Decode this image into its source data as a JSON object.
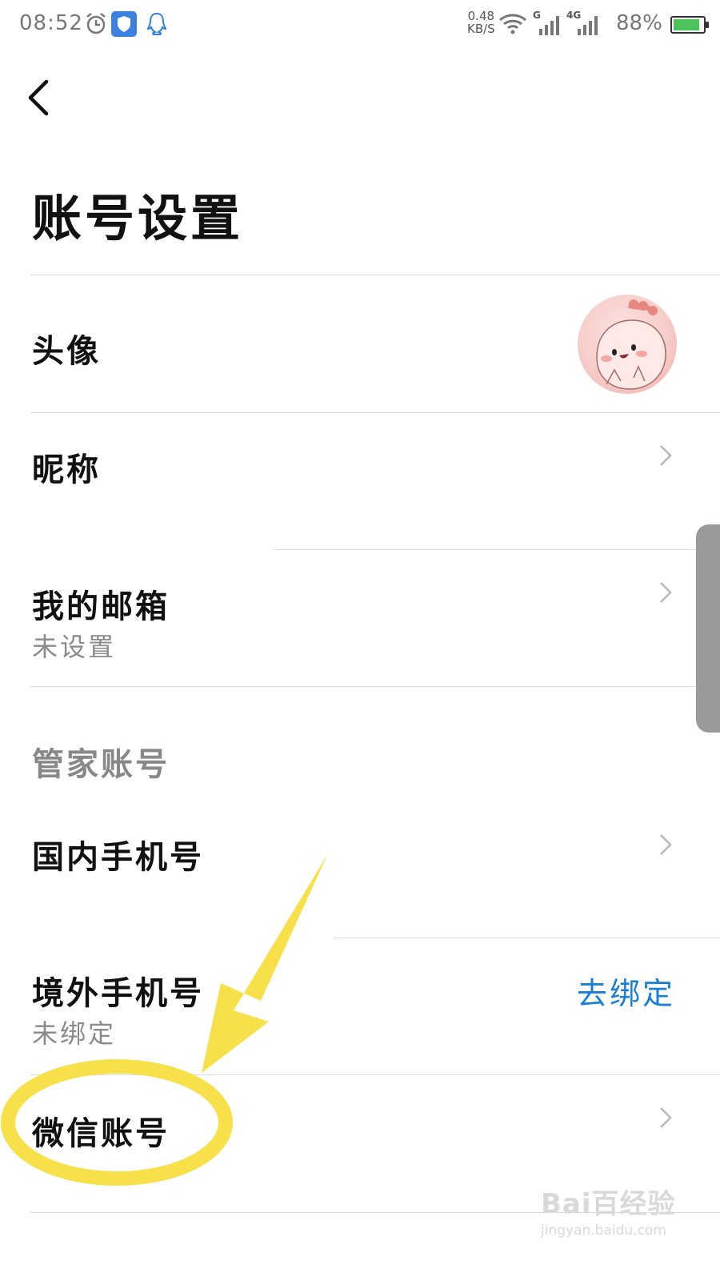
{
  "status_bar": {
    "time": "08:52",
    "network_speed_value": "0.48",
    "network_speed_unit": "KB/S",
    "signal_1_label": "G",
    "signal_2_label": "4G",
    "battery_percent": "88%",
    "battery_level": 0.88,
    "icons": [
      "alarm-icon",
      "shield-icon",
      "qq-icon",
      "wifi-icon",
      "signal-icon",
      "battery-icon"
    ]
  },
  "header": {
    "back_icon": "chevron-left-icon",
    "title": "账号设置"
  },
  "rows": {
    "avatar": {
      "label": "头像"
    },
    "nickname": {
      "label": "昵称"
    },
    "email": {
      "label": "我的邮箱",
      "sub": "未设置"
    },
    "manager_section": {
      "title": "管家账号"
    },
    "domestic_phone": {
      "label": "国内手机号"
    },
    "overseas_phone": {
      "label": "境外手机号",
      "sub": "未绑定",
      "action": "去绑定"
    },
    "wechat": {
      "label": "微信账号"
    }
  },
  "colors": {
    "accent_link": "#1a7fd6",
    "secondary_text": "#8a8a8a",
    "annotation_yellow": "#f7e04a",
    "battery_green": "#4cc35a"
  },
  "watermark": {
    "main": "Bai百经验",
    "sub": "jingyan.baidu.com"
  }
}
